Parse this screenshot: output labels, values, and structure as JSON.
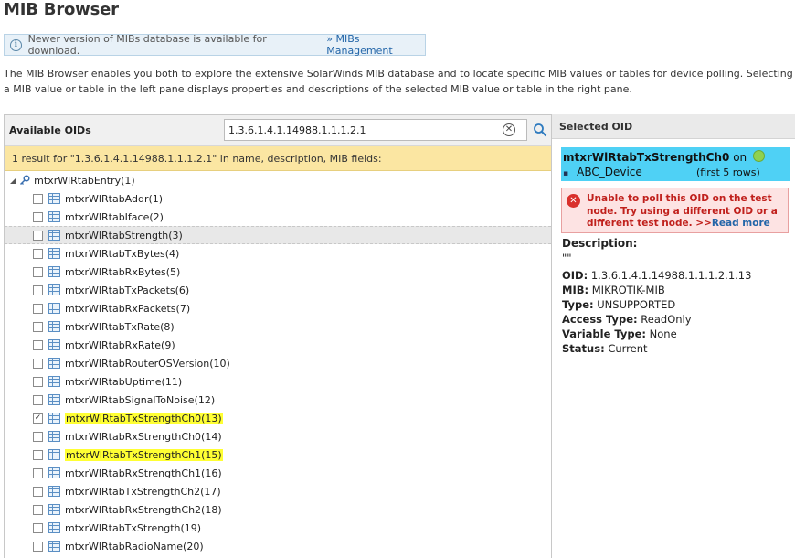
{
  "page": {
    "title": "MIB Browser"
  },
  "notice": {
    "text": "Newer version of MIBs database is available for download.",
    "link": "» MIBs Management"
  },
  "intro": {
    "line1": "The MIB Browser enables you both to explore the extensive SolarWinds MIB database and to locate specific MIB values or tables for device polling. Selecting",
    "line2": "a MIB value or table in the left pane displays properties and descriptions of the selected MIB value or table in the right pane."
  },
  "left": {
    "header_label": "Available OIDs",
    "search_value": "1.3.6.1.4.1.14988.1.1.1.2.1",
    "result_text": "1 result for \"1.3.6.1.4.1.14988.1.1.1.2.1\" in name, description, MIB fields:",
    "root": {
      "label": "mtxrWlRtabEntry(1)"
    },
    "rows": [
      {
        "label": "mtxrWlRtabAddr(1)",
        "checked": false,
        "highlight": false,
        "hovered": false
      },
      {
        "label": "mtxrWlRtabIface(2)",
        "checked": false,
        "highlight": false,
        "hovered": false
      },
      {
        "label": "mtxrWlRtabStrength(3)",
        "checked": false,
        "highlight": false,
        "hovered": true
      },
      {
        "label": "mtxrWlRtabTxBytes(4)",
        "checked": false,
        "highlight": false,
        "hovered": false
      },
      {
        "label": "mtxrWlRtabRxBytes(5)",
        "checked": false,
        "highlight": false,
        "hovered": false
      },
      {
        "label": "mtxrWlRtabTxPackets(6)",
        "checked": false,
        "highlight": false,
        "hovered": false
      },
      {
        "label": "mtxrWlRtabRxPackets(7)",
        "checked": false,
        "highlight": false,
        "hovered": false
      },
      {
        "label": "mtxrWlRtabTxRate(8)",
        "checked": false,
        "highlight": false,
        "hovered": false
      },
      {
        "label": "mtxrWlRtabRxRate(9)",
        "checked": false,
        "highlight": false,
        "hovered": false
      },
      {
        "label": "mtxrWlRtabRouterOSVersion(10)",
        "checked": false,
        "highlight": false,
        "hovered": false
      },
      {
        "label": "mtxrWlRtabUptime(11)",
        "checked": false,
        "highlight": false,
        "hovered": false
      },
      {
        "label": "mtxrWlRtabSignalToNoise(12)",
        "checked": false,
        "highlight": false,
        "hovered": false
      },
      {
        "label": "mtxrWlRtabTxStrengthCh0(13)",
        "checked": true,
        "highlight": true,
        "hovered": false
      },
      {
        "label": "mtxrWlRtabRxStrengthCh0(14)",
        "checked": false,
        "highlight": false,
        "hovered": false
      },
      {
        "label": "mtxrWlRtabTxStrengthCh1(15)",
        "checked": false,
        "highlight": true,
        "hovered": false
      },
      {
        "label": "mtxrWlRtabRxStrengthCh1(16)",
        "checked": false,
        "highlight": false,
        "hovered": false
      },
      {
        "label": "mtxrWlRtabTxStrengthCh2(17)",
        "checked": false,
        "highlight": false,
        "hovered": false
      },
      {
        "label": "mtxrWlRtabRxStrengthCh2(18)",
        "checked": false,
        "highlight": false,
        "hovered": false
      },
      {
        "label": "mtxrWlRtabTxStrength(19)",
        "checked": false,
        "highlight": false,
        "hovered": false
      },
      {
        "label": "mtxrWlRtabRadioName(20)",
        "checked": false,
        "highlight": false,
        "hovered": false
      }
    ]
  },
  "right": {
    "header_label": "Selected OID",
    "selected": {
      "oid_name": "mtxrWlRtabTxStrengthCh0",
      "on_text": "on",
      "device": "ABC_Device",
      "rows_hint": "(first 5 rows)"
    },
    "error": {
      "text": "Unable to poll this OID on the test node. Try using a different OID or a different test node. >>",
      "link": "Read more"
    },
    "description_label": "Description:",
    "description_value": "\"\"",
    "props": {
      "oid_label": "OID:",
      "oid_value": "1.3.6.1.4.1.14988.1.1.1.2.1.13",
      "mib_label": "MIB:",
      "mib_value": "MIKROTIK-MIB",
      "type_label": "Type:",
      "type_value": "UNSUPPORTED",
      "access_label": "Access Type:",
      "access_value": "ReadOnly",
      "var_label": "Variable Type:",
      "var_value": "None",
      "status_label": "Status:",
      "status_value": "Current"
    }
  },
  "colors": {
    "highlight": "#ffff33",
    "selected_card": "#4fd1f5",
    "result_bar": "#fbe6a2",
    "error": "#c0201c"
  }
}
